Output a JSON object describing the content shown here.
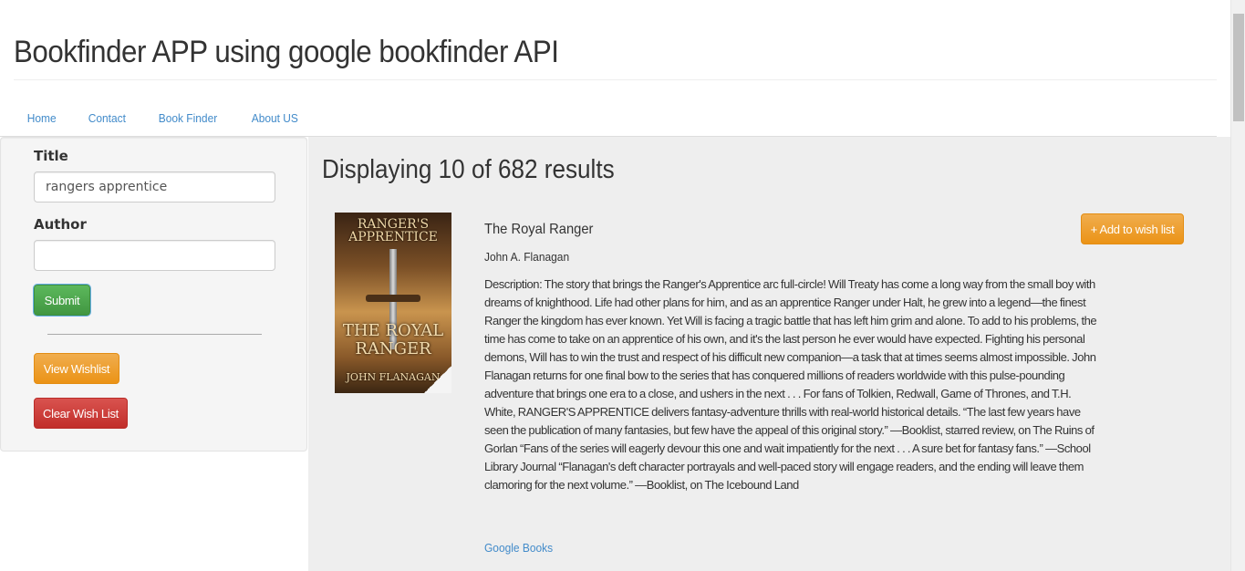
{
  "app": {
    "title": "Bookfinder APP using google bookfinder API"
  },
  "nav": {
    "items": [
      {
        "label": "Home"
      },
      {
        "label": "Contact"
      },
      {
        "label": "Book Finder"
      },
      {
        "label": "About US"
      }
    ]
  },
  "sidebar": {
    "title_label": "Title",
    "title_value": "rangers apprentice",
    "author_label": "Author",
    "author_value": "",
    "submit_label": "Submit",
    "view_wishlist_label": "View Wishlist",
    "clear_wishlist_label": "Clear Wish List"
  },
  "results": {
    "heading": "Displaying 10 of 682 results",
    "items": [
      {
        "title": "The Royal Ranger",
        "author": "John A. Flanagan",
        "description": "Description: The story that brings the Ranger's Apprentice arc full-circle! Will Treaty has come a long way from the small boy with dreams of knighthood. Life had other plans for him, and as an apprentice Ranger under Halt, he grew into a legend—the finest Ranger the kingdom has ever known. Yet Will is facing a tragic battle that has left him grim and alone. To add to his problems, the time has come to take on an apprentice of his own, and it's the last person he ever would have expected. Fighting his personal demons, Will has to win the trust and respect of his difficult new companion—a task that at times seems almost impossible. John Flanagan returns for one final bow to the series that has conquered millions of readers worldwide with this pulse-pounding adventure that brings one era to a close, and ushers in the next . . . For fans of Tolkien, Redwall, Game of Thrones, and T.H. White, RANGER'S APPRENTICE delivers fantasy-adventure thrills with real-world historical details. “The last few years have seen the publication of many fantasies, but few have the appeal of this original story.” —Booklist, starred review, on The Ruins of Gorlan “Fans of the series will eagerly devour this one and wait impatiently for the next . . . A sure bet for fantasy fans.” —School Library Journal “Flanagan's deft character portrayals and well-paced story will engage readers, and the ending will leave them clamoring for the next volume.” —Booklist, on The Icebound Land",
        "link_label": "Google Books",
        "add_label": "+ Add to wish list",
        "cover": {
          "series_text": "RANGER'S APPRENTICE",
          "title_text": "THE ROYAL RANGER",
          "author_text": "JOHN FLANAGAN"
        }
      }
    ]
  },
  "colors": {
    "link": "#428bca",
    "success": "#5cb85c",
    "warning": "#f0ad4e",
    "danger": "#d9534f",
    "panel": "#f5f5f5",
    "results_bg": "#eeeeee"
  }
}
